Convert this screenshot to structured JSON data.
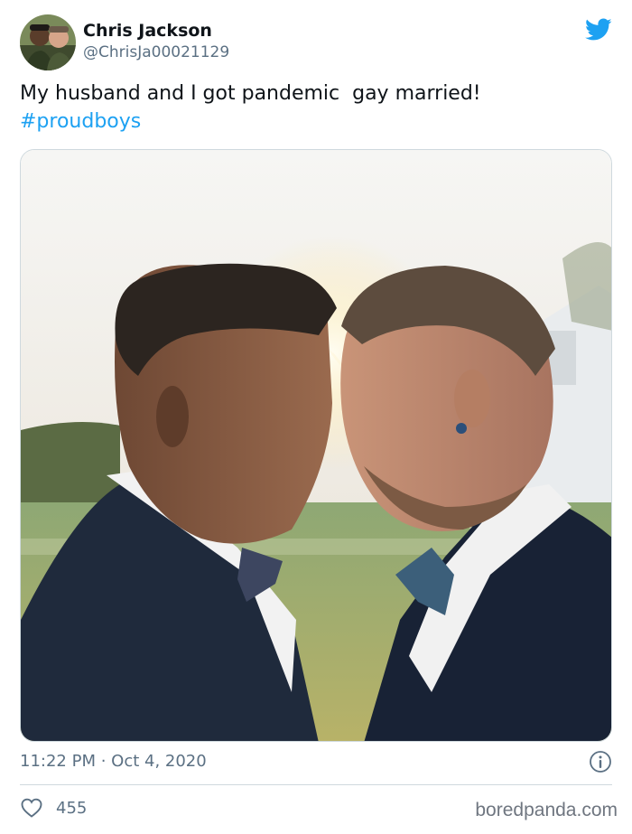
{
  "tweet": {
    "author": {
      "display_name": "Chris Jackson",
      "handle": "@ChrisJa00021129"
    },
    "text_line_1": "My husband and I got pandemic  gay married!",
    "hashtag": "#proudboys",
    "timestamp": "11:22 PM · Oct 4, 2020",
    "likes": "455"
  },
  "icons": {
    "brand": "twitter-bird-icon",
    "info": "info-icon",
    "like": "heart-icon"
  },
  "watermark": "boredpanda.com",
  "colors": {
    "twitter_blue": "#1da1f2",
    "text_primary": "#0f1419",
    "text_secondary": "#5b7083",
    "border": "#cfd9de"
  }
}
